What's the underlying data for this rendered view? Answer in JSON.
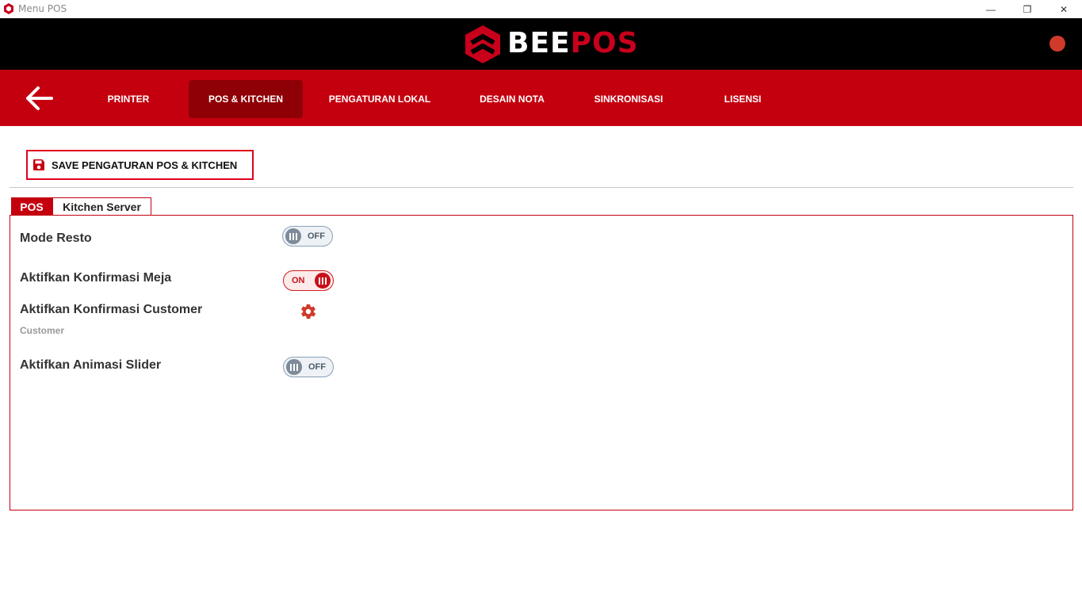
{
  "window": {
    "title": "Menu POS",
    "minimize_glyph": "—",
    "maximize_glyph": "❐",
    "close_glyph": "✕"
  },
  "brand": {
    "name_part1": "BEE",
    "name_part2": "POS",
    "accent_color": "#c8001c"
  },
  "nav": {
    "back_icon": "arrow-left-icon",
    "items": [
      {
        "label": "PRINTER"
      },
      {
        "label": "POS & KITCHEN",
        "active": true
      },
      {
        "label": "PENGATURAN LOKAL"
      },
      {
        "label": "DESAIN NOTA"
      },
      {
        "label": "SINKRONISASI"
      },
      {
        "label": "LISENSI"
      }
    ]
  },
  "toolbar": {
    "save_label": "SAVE PENGATURAN POS & KITCHEN"
  },
  "tabs": [
    {
      "label": "POS",
      "active": true
    },
    {
      "label": "Kitchen Server"
    }
  ],
  "settings": [
    {
      "label": "Mode Resto",
      "state": "OFF"
    },
    {
      "label": "Aktifkan Konfirmasi Meja",
      "state": "ON"
    },
    {
      "label": "Aktifkan Konfirmasi Customer",
      "sub": "Customer",
      "control": "gear-icon"
    },
    {
      "label": "Aktifkan Animasi Slider",
      "state": "OFF"
    }
  ]
}
